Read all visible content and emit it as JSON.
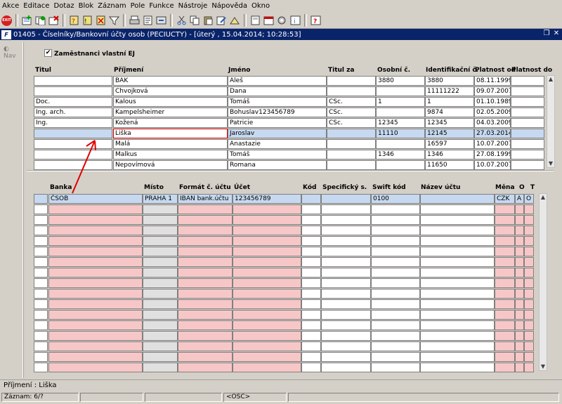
{
  "menubar": {
    "items": [
      "Akce",
      "Editace",
      "Dotaz",
      "Blok",
      "Záznam",
      "Pole",
      "Funkce",
      "Nástroje",
      "Nápověda",
      "Okno"
    ]
  },
  "toolbar": {
    "exit_label": "EXIT"
  },
  "window": {
    "title": "01405 - Číselníky/Bankovní účty osob (PECIUCTY) - [úterý  , 15.04.2014; 10:28:53]",
    "logo": "F"
  },
  "nav": {
    "label": "Nav"
  },
  "filter": {
    "checkbox_label": "Zaměstnanci vlastní EJ",
    "checked": "✔"
  },
  "persons": {
    "headers": {
      "titul": "Titul",
      "prijmeni": "Příjmení",
      "jmeno": "Jméno",
      "titul_za": "Titul za",
      "osobni": "Osobní č.",
      "ident": "Identifikační č.",
      "platnost_od": "Platnost od",
      "platnost_do": "Platnost do"
    },
    "rows": [
      {
        "titul": "",
        "prijmeni": "BAK",
        "jmeno": "Aleš",
        "titul_za": "",
        "osobni": "3880",
        "ident": "3880",
        "od": "08.11.1999",
        "do": ""
      },
      {
        "titul": "",
        "prijmeni": "Chvojková",
        "jmeno": "Dana",
        "titul_za": "",
        "osobni": "",
        "ident": "11111222",
        "od": "09.07.2007",
        "do": ""
      },
      {
        "titul": "Doc.",
        "prijmeni": "Kalous",
        "jmeno": "Tomáš",
        "titul_za": "CSc.",
        "osobni": "1",
        "ident": "1",
        "od": "01.10.1989",
        "do": ""
      },
      {
        "titul": "Ing. arch.",
        "prijmeni": "Kampelsheimer",
        "jmeno": "Bohuslav123456789",
        "titul_za": "CSc.",
        "osobni": "",
        "ident": "9874",
        "od": "02.05.2009",
        "do": ""
      },
      {
        "titul": "Ing.",
        "prijmeni": "Kožená",
        "jmeno": "Patricie",
        "titul_za": "CSc.",
        "osobni": "12345",
        "ident": "12345",
        "od": "04.03.2009",
        "do": ""
      },
      {
        "titul": "",
        "prijmeni": "Liška",
        "jmeno": "Jaroslav",
        "titul_za": "",
        "osobni": "11110",
        "ident": "12145",
        "od": "27.03.2014",
        "do": ""
      },
      {
        "titul": "",
        "prijmeni": "Malá",
        "jmeno": "Anastazie",
        "titul_za": "",
        "osobni": "",
        "ident": "16597",
        "od": "10.07.2007",
        "do": ""
      },
      {
        "titul": "",
        "prijmeni": "Malkus",
        "jmeno": "Tomáš",
        "titul_za": "",
        "osobni": "1346",
        "ident": "1346",
        "od": "27.08.1999",
        "do": ""
      },
      {
        "titul": "",
        "prijmeni": "Nepovímová",
        "jmeno": "Romana",
        "titul_za": "",
        "osobni": "",
        "ident": "11650",
        "od": "10.07.2007",
        "do": ""
      }
    ]
  },
  "accounts": {
    "headers": {
      "banka": "Banka",
      "misto": "Místo",
      "format": "Formát č. účtu",
      "ucet": "Účet",
      "kod": "Kód",
      "spec": "Specifický s.",
      "swift": "Swift kód",
      "nazev": "Název účtu",
      "mena": "Měna",
      "o": "O",
      "t": "T"
    },
    "rows": [
      {
        "banka": "ČSOB",
        "misto": "PRAHA 1",
        "format": "IBAN bank.účtu",
        "ucet": "123456789",
        "kod": "",
        "spec": "",
        "swift": "0100",
        "nazev": "",
        "mena": "CZK",
        "o": "A",
        "t": "O"
      }
    ]
  },
  "status": {
    "message": "Příjmení : Liška",
    "record": "Záznam: 6/?",
    "field2": "",
    "field3": "",
    "mode": "<OSC>"
  }
}
